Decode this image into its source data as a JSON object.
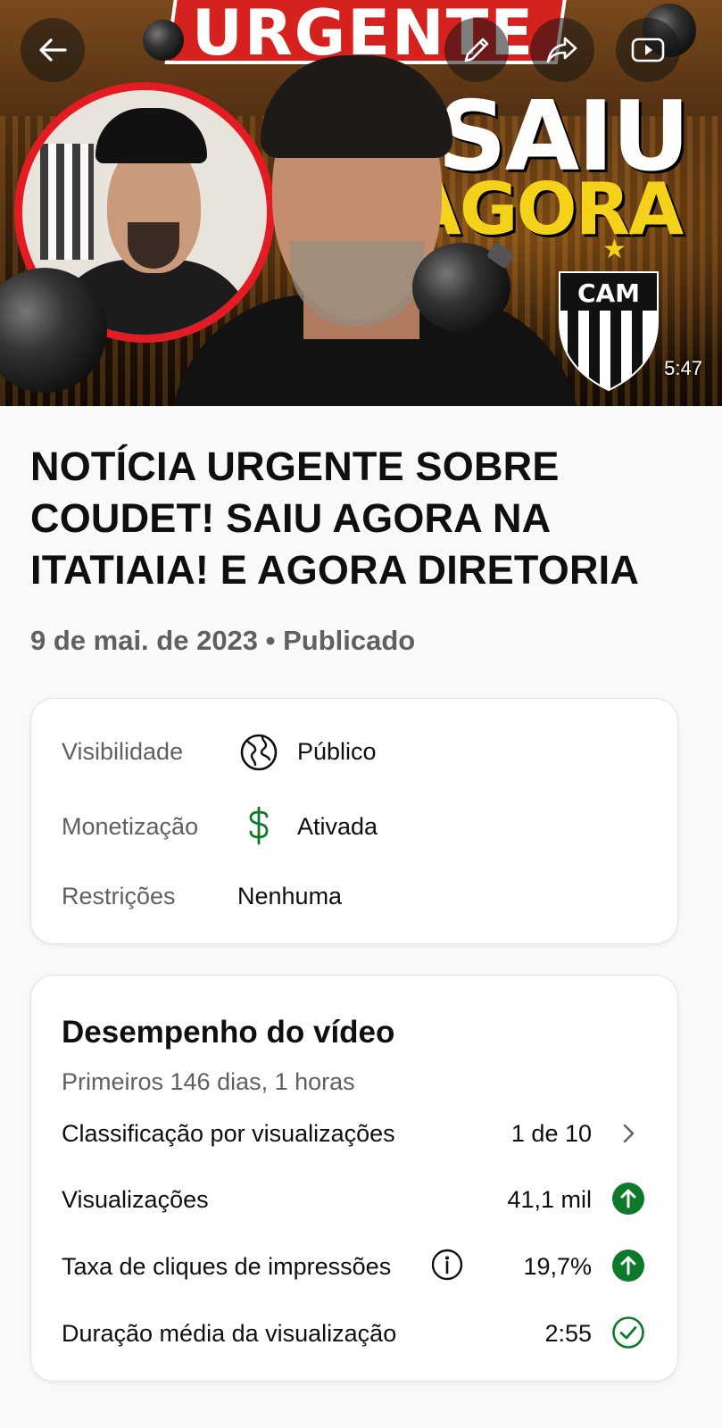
{
  "thumbnail": {
    "headline_top": "URGENTE",
    "headline_mid": "SAIU",
    "headline_bottom": "AGORA",
    "crest_text": "CAM",
    "duration": "5:47"
  },
  "top_actions": {
    "back_icon": "arrow-left-icon",
    "edit_icon": "pencil-icon",
    "share_icon": "share-icon",
    "youtube_icon": "youtube-icon"
  },
  "video": {
    "title": "NOTÍCIA URGENTE SOBRE COUDET! SAIU AGORA NA ITATIAIA! E AGORA DIRETORIA",
    "date_line": "9 de mai. de 2023 • Publicado"
  },
  "details": {
    "visibility_label": "Visibilidade",
    "visibility_value": "Público",
    "monetization_label": "Monetização",
    "monetization_value": "Ativada",
    "restrictions_label": "Restrições",
    "restrictions_value": "Nenhuma"
  },
  "performance": {
    "title": "Desempenho do vídeo",
    "subtitle": "Primeiros 146 dias, 1 horas",
    "metrics": [
      {
        "label": "Classificação por visualizações",
        "value": "1 de 10",
        "indicator": "chevron-right-icon"
      },
      {
        "label": "Visualizações",
        "value": "41,1 mil",
        "indicator": "arrow-up-circle-icon"
      },
      {
        "label": "Taxa de cliques de impressões",
        "value": "19,7%",
        "indicator": "arrow-up-circle-icon"
      },
      {
        "label": "Duração média da visualização",
        "value": "2:55",
        "indicator": "check-circle-icon"
      }
    ]
  },
  "colors": {
    "accent_green": "#0b7a2a",
    "muted_text": "#606060",
    "thumbnail_red": "#d6221f",
    "thumbnail_yellow": "#f5d21a"
  }
}
